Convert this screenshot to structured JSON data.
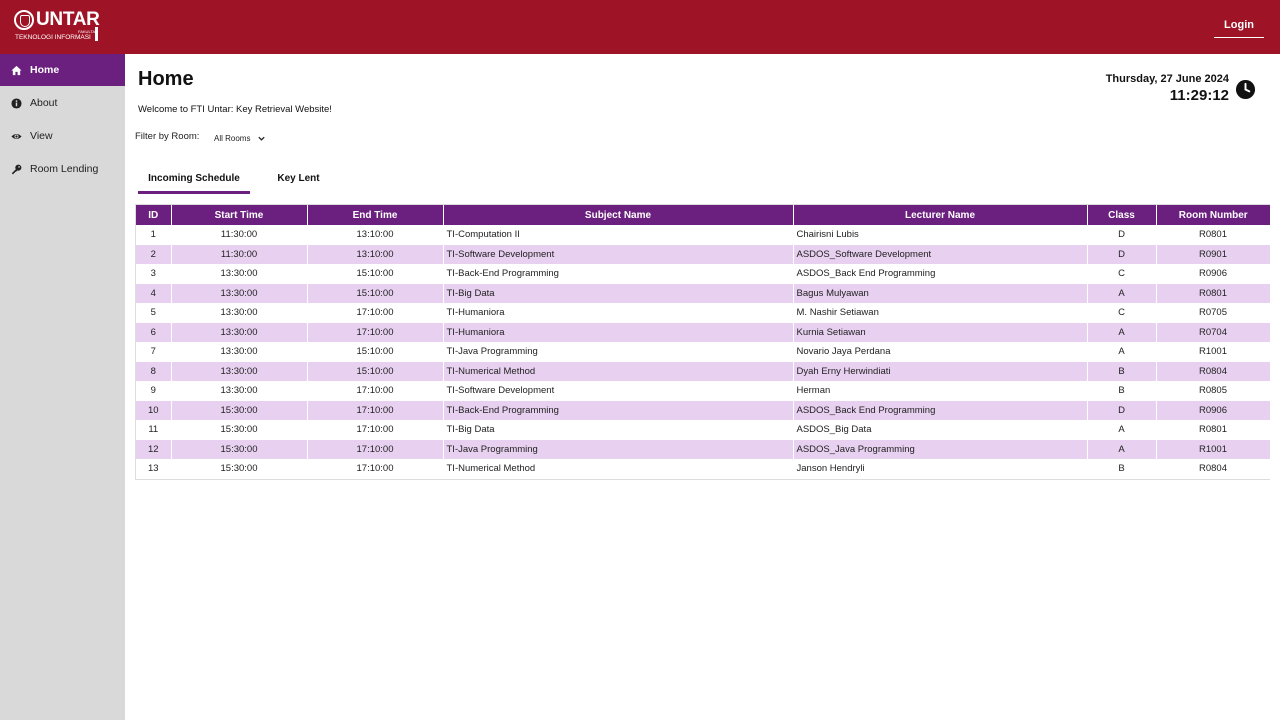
{
  "header": {
    "logo_text": "UNTAR",
    "logo_fakultas": "FAKULTAS",
    "logo_sub": "TEKNOLOGI INFORMASI",
    "login_label": "Login",
    "bg_color": "#9e1426"
  },
  "sidebar": {
    "items": [
      {
        "label": "Home",
        "icon": "home-icon"
      },
      {
        "label": "About",
        "icon": "info-icon"
      },
      {
        "label": "View",
        "icon": "eye-icon"
      },
      {
        "label": "Room Lending",
        "icon": "key-icon"
      }
    ],
    "active_color": "#6b1f7e"
  },
  "main": {
    "title": "Home",
    "welcome": "Welcome to FTI Untar: Key Retrieval Website!",
    "filter_label": "Filter by Room:",
    "filter_value": "All Rooms",
    "date": "Thursday, 27 June 2024",
    "time": "11:29:12"
  },
  "tabs": [
    {
      "label": "Incoming Schedule"
    },
    {
      "label": "Key Lent"
    }
  ],
  "table": {
    "headers": [
      "ID",
      "Start Time",
      "End Time",
      "Subject Name",
      "Lecturer Name",
      "Class",
      "Room Number"
    ],
    "rows": [
      [
        "1",
        "11:30:00",
        "13:10:00",
        "TI-Computation II",
        "Chairisni Lubis",
        "D",
        "R0801"
      ],
      [
        "2",
        "11:30:00",
        "13:10:00",
        "TI-Software Development",
        "ASDOS_Software Development",
        "D",
        "R0901"
      ],
      [
        "3",
        "13:30:00",
        "15:10:00",
        "TI-Back-End Programming",
        "ASDOS_Back End Programming",
        "C",
        "R0906"
      ],
      [
        "4",
        "13:30:00",
        "15:10:00",
        "TI-Big Data",
        "Bagus Mulyawan",
        "A",
        "R0801"
      ],
      [
        "5",
        "13:30:00",
        "17:10:00",
        "TI-Humaniora",
        "M. Nashir Setiawan",
        "C",
        "R0705"
      ],
      [
        "6",
        "13:30:00",
        "17:10:00",
        "TI-Humaniora",
        "Kurnia Setiawan",
        "A",
        "R0704"
      ],
      [
        "7",
        "13:30:00",
        "15:10:00",
        "TI-Java Programming",
        "Novario Jaya Perdana",
        "A",
        "R1001"
      ],
      [
        "8",
        "13:30:00",
        "15:10:00",
        "TI-Numerical Method",
        "Dyah Erny Herwindiati",
        "B",
        "R0804"
      ],
      [
        "9",
        "13:30:00",
        "17:10:00",
        "TI-Software Development",
        "Herman",
        "B",
        "R0805"
      ],
      [
        "10",
        "15:30:00",
        "17:10:00",
        "TI-Back-End Programming",
        "ASDOS_Back End Programming",
        "D",
        "R0906"
      ],
      [
        "11",
        "15:30:00",
        "17:10:00",
        "TI-Big Data",
        "ASDOS_Big Data",
        "A",
        "R0801"
      ],
      [
        "12",
        "15:30:00",
        "17:10:00",
        "TI-Java Programming",
        "ASDOS_Java Programming",
        "A",
        "R1001"
      ],
      [
        "13",
        "15:30:00",
        "17:10:00",
        "TI-Numerical Method",
        "Janson Hendryli",
        "B",
        "R0804"
      ]
    ],
    "header_color": "#6b1f7e",
    "stripe_color": "#e8d1f0"
  }
}
